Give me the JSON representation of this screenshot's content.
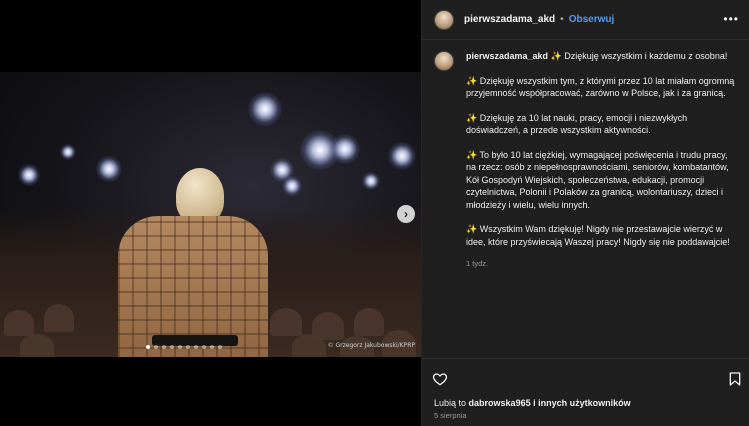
{
  "post": {
    "username": "pierwszadama_akd",
    "separator": "•",
    "follow_label": "Obserwuj",
    "more_icon": "more-options-icon",
    "caption": {
      "first_line": "✨ Dziękuję wszystkim i każdemu z osobna!",
      "paragraphs": [
        "✨ Dziękuję wszystkim tym, z którymi przez 10 lat miałam ogromną przyjemność współpracować, zarówno w Polsce, jak i za granicą.",
        "✨ Dziękuję za 10 lat nauki, pracy, emocji i niezwykłych doświadczeń, a przede wszystkim aktywności.",
        "✨ To było 10 lat ciężkiej, wymagającej poświęcenia i trudu pracy, na rzecz: osób z niepełnosprawnościami, seniorów, kombatantów, Kół Gospodyń Wiejskich, społeczeństwa, edukacji, promocji czytelnictwa, Polonii i Polaków za granicą, wolontariuszy, dzieci i młodzieży i wielu, wielu innych.",
        "✨ Wszystkim Wam dziękuję! Nigdy nie przestawajcie wierzyć w idee, które przyświecają Waszej pracy! Nigdy się nie poddawajcie!"
      ],
      "time_ago": "1 tydz."
    },
    "likes": {
      "prefix": "Lubią to",
      "user": "dabrowska965",
      "suffix": "i innych użytkowników"
    },
    "date": "5 sierpnia"
  },
  "media": {
    "photo_credit": "© Grzegorz Jakubowski/KPRP",
    "carousel_count": 10,
    "carousel_active": 1,
    "next_icon": "chevron-right-icon"
  },
  "actions": {
    "like_icon": "heart-icon",
    "save_icon": "bookmark-icon"
  },
  "colors": {
    "panel_bg": "#1f1f1f",
    "follow": "#4e9bf5",
    "muted": "#9a9a9a"
  }
}
